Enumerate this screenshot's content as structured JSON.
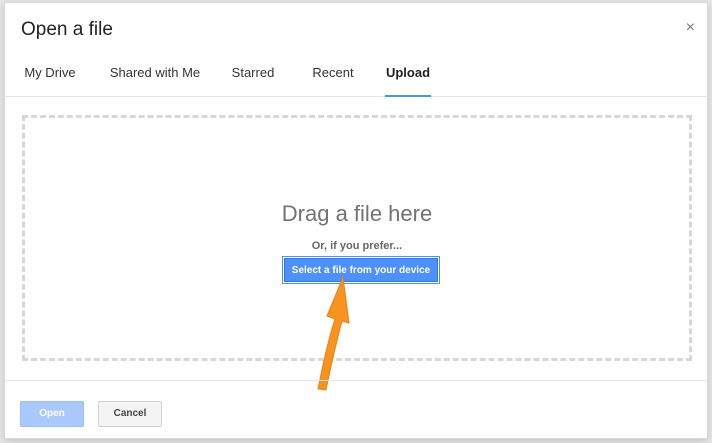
{
  "dialog": {
    "title": "Open a file",
    "close_glyph": "×"
  },
  "tabs": [
    {
      "label": "My Drive",
      "active": false
    },
    {
      "label": "Shared with Me",
      "active": false
    },
    {
      "label": "Starred",
      "active": false
    },
    {
      "label": "Recent",
      "active": false
    },
    {
      "label": "Upload",
      "active": true
    }
  ],
  "upload": {
    "drag_text": "Drag a file here",
    "prefer_text": "Or, if you prefer...",
    "select_button_label": "Select a file from your device"
  },
  "footer": {
    "open_label": "Open",
    "cancel_label": "Cancel"
  },
  "colors": {
    "accent": "#4d90fe",
    "arrow": "#f7931e",
    "open_disabled": "#a9c8fb"
  },
  "icons": {
    "close": "close-icon",
    "annotation_arrow": "arrow-up-icon"
  }
}
